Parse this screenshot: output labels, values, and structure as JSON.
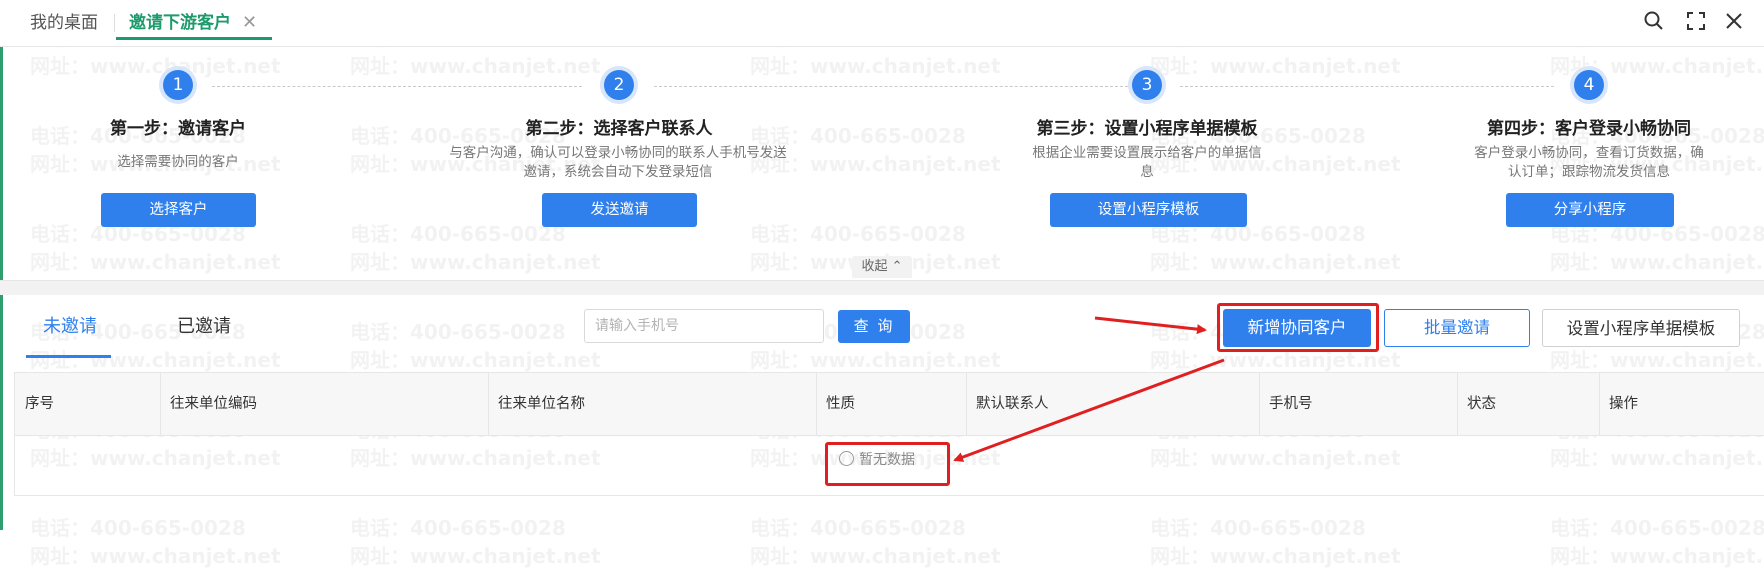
{
  "tabs": {
    "home_label": "我的桌面",
    "active_label": "邀请下游客户",
    "close_glyph": "✕"
  },
  "toolbar": {
    "search_glyph": "⌕",
    "expand_glyph": "⛶",
    "close_glyph": "✕"
  },
  "steps": [
    {
      "number": "1",
      "title": "第一步：邀请客户",
      "desc": "选择需要协同的客户",
      "button": "选择客户"
    },
    {
      "number": "2",
      "title": "第二步：选择客户联系人",
      "desc": "与客户沟通，确认可以登录小畅协同的联系人手机号发送邀请，系统会自动下发登录短信",
      "button": "发送邀请"
    },
    {
      "number": "3",
      "title": "第三步：设置小程序单据模板",
      "desc": "根据企业需要设置展示给客户的单据信息",
      "button": "设置小程序模板"
    },
    {
      "number": "4",
      "title": "第四步：客户登录小畅协同",
      "desc": "客户登录小畅协同，查看订货数据，确认订单；跟踪物流发货信息",
      "button": "分享小程序"
    }
  ],
  "collapse_label": "收起 ⌃",
  "subtabs": {
    "uninvited": "未邀请",
    "invited": "已邀请"
  },
  "search": {
    "placeholder": "请输入手机号",
    "query_label": "查 询"
  },
  "actions": {
    "add_customer": "新增协同客户",
    "batch_invite": "批量邀请",
    "set_template": "设置小程序单据模板"
  },
  "table": {
    "headers": [
      "序号",
      "往来单位编码",
      "往来单位名称",
      "性质",
      "默认联系人",
      "手机号",
      "状态",
      "操作"
    ],
    "empty_text": "暂无数据"
  },
  "watermark": {
    "phone": "电话：400-665-0028",
    "site": "网址：www.chanjet.net"
  },
  "colors": {
    "brand_green": "#1d9b6c",
    "primary_blue": "#2f80ed",
    "annotation_red": "#e02020"
  }
}
